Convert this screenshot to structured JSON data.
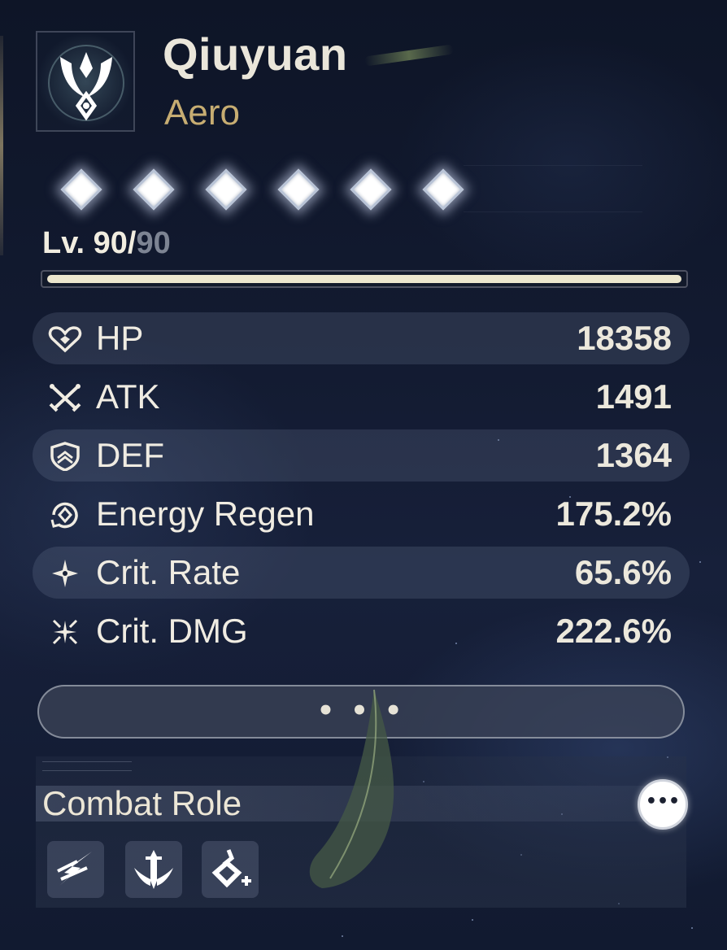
{
  "character": {
    "name": "Qiuyuan",
    "element": "Aero",
    "emblem_icon": "aero-element-icon",
    "accent_color": "#c7ad72"
  },
  "sequence": {
    "nodes_total": 6,
    "nodes_active": 6,
    "node_icon": "diamond-icon"
  },
  "level": {
    "prefix": "Lv. ",
    "current": "90",
    "separator": "/",
    "max": "90",
    "progress": 1.0
  },
  "stats": [
    {
      "id": "hp",
      "icon": "heart-icon",
      "name": "HP",
      "value": "18358",
      "shaded": true
    },
    {
      "id": "atk",
      "icon": "crossed-swords-icon",
      "name": "ATK",
      "value": "1491",
      "shaded": false
    },
    {
      "id": "def",
      "icon": "shield-icon",
      "name": "DEF",
      "value": "1364",
      "shaded": true
    },
    {
      "id": "energy-regen",
      "icon": "energy-regen-icon",
      "name": "Energy Regen",
      "value": "175.2%",
      "shaded": false
    },
    {
      "id": "crit-rate",
      "icon": "sparkle-icon",
      "name": "Crit. Rate",
      "value": "65.6%",
      "shaded": true
    },
    {
      "id": "crit-dmg",
      "icon": "burst-icon",
      "name": "Crit. DMG",
      "value": "222.6%",
      "shaded": false
    }
  ],
  "more_button": {
    "label": "• • •"
  },
  "combat_role": {
    "title": "Combat Role",
    "info_label": "•••",
    "roles": [
      {
        "icon": "lightning-strike-icon"
      },
      {
        "icon": "sword-wings-icon"
      },
      {
        "icon": "support-heal-icon"
      }
    ]
  }
}
